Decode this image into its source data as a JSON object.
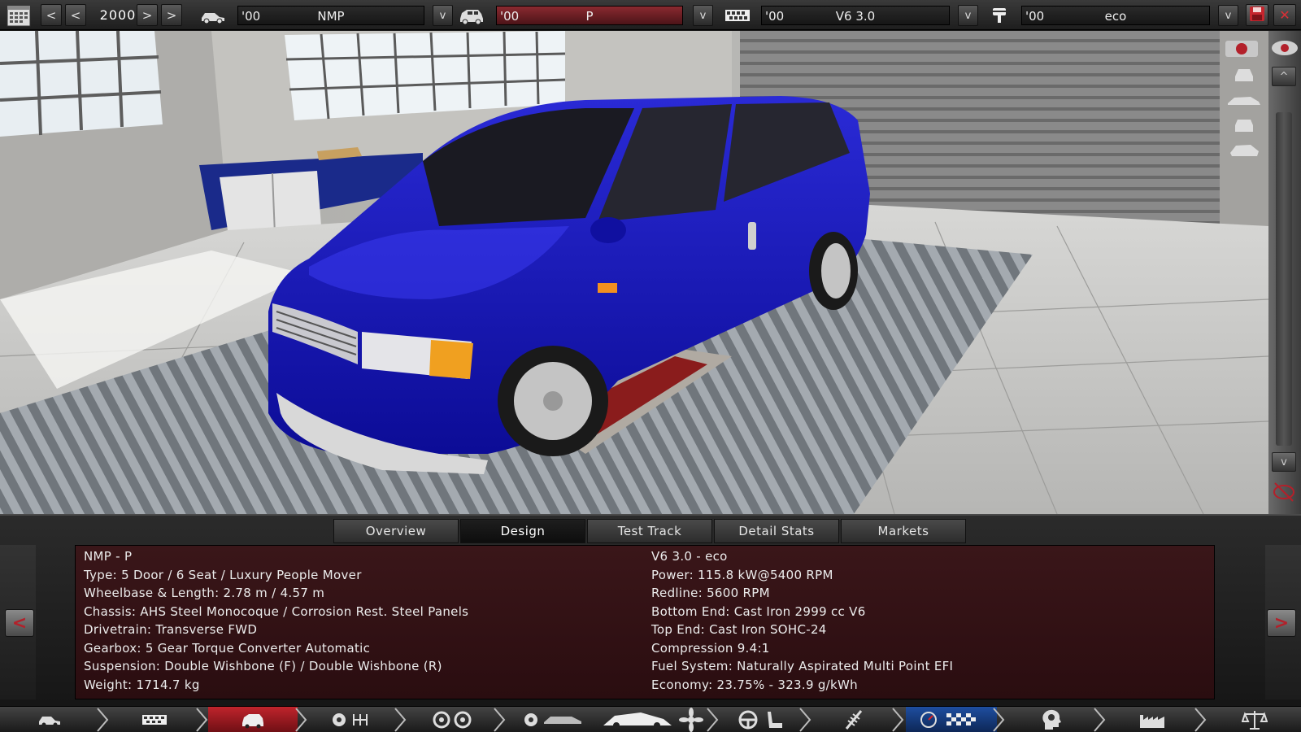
{
  "topbar": {
    "year": "2000",
    "model": {
      "year": "'00",
      "name": "NMP"
    },
    "trim": {
      "year": "'00",
      "name": "P"
    },
    "engine": {
      "year": "'00",
      "name": "V6 3.0"
    },
    "engine_variant": {
      "year": "'00",
      "name": "eco"
    },
    "prev_label": "<",
    "next_label": ">",
    "dropdown_label": "v",
    "close_label": "✕"
  },
  "right_tools": {
    "up_label": "^",
    "down_label": "v"
  },
  "tabs": [
    {
      "label": "Overview"
    },
    {
      "label": "Design"
    },
    {
      "label": "Test Track"
    },
    {
      "label": "Detail Stats"
    },
    {
      "label": "Markets"
    }
  ],
  "active_tab": "Design",
  "info": {
    "left": [
      "NMP - P",
      "Type: 5 Door / 6 Seat / Luxury People Mover",
      "Wheelbase & Length: 2.78 m / 4.57 m",
      "Chassis: AHS Steel Monocoque / Corrosion Rest. Steel Panels",
      "Drivetrain: Transverse FWD",
      "Gearbox: 5 Gear Torque Converter Automatic",
      "Suspension: Double Wishbone (F) / Double Wishbone (R)",
      "Weight: 1714.7 kg"
    ],
    "right": [
      "V6 3.0 - eco",
      "Power: 115.8 kW@5400 RPM",
      "Redline: 5600 RPM",
      "Bottom End: Cast Iron 2999 cc V6",
      "Top End: Cast Iron SOHC-24",
      "Compression 9.4:1",
      "Fuel System: Naturally Aspirated Multi Point EFI",
      "Economy: 23.75% - 323.9 g/kWh"
    ]
  },
  "panel_nav": {
    "prev_label": "<",
    "next_label": ">"
  },
  "bottom_nav": [
    {
      "icon": "car-model-icon"
    },
    {
      "icon": "chassis-icon"
    },
    {
      "icon": "trim-body-icon",
      "active": "red"
    },
    {
      "icon": "engine-gears-icon"
    },
    {
      "icon": "wheels-icon"
    },
    {
      "icon": "car-body-icon"
    },
    {
      "icon": "car-design-fan-icon"
    },
    {
      "icon": "steering-seat-icon"
    },
    {
      "icon": "suspension-icon"
    },
    {
      "icon": "gauge-flag-icon",
      "active": "blue"
    },
    {
      "icon": "head-mind-icon"
    },
    {
      "icon": "factory-icon"
    },
    {
      "icon": "scales-icon"
    }
  ],
  "colors": {
    "car_body": "#1414b4",
    "accent_red": "#b3202a",
    "panel_bg": "#32121a",
    "active_blue": "#1e4ea0"
  }
}
